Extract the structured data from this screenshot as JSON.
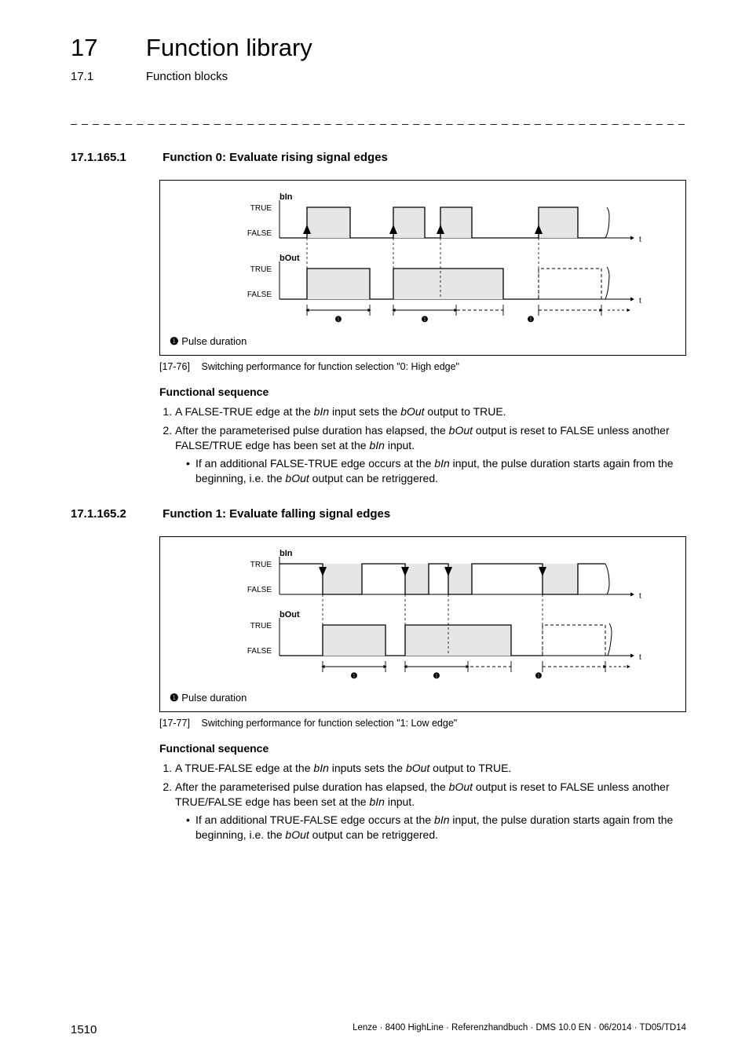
{
  "chapter": {
    "number": "17",
    "title": "Function library"
  },
  "subsection": {
    "number": "17.1",
    "title": "Function blocks"
  },
  "dashline": "_ _ _ _ _ _ _ _ _ _ _ _ _ _ _ _ _ _ _ _ _ _ _ _ _ _ _ _ _ _ _ _ _ _ _ _ _ _ _ _ _ _ _ _ _ _ _ _ _ _ _ _ _ _ _ _ _ _ _ _ _ _ _ _",
  "section1": {
    "number": "17.1.165.1",
    "title": "Function 0: Evaluate rising signal edges",
    "fig": {
      "bIn": "bIn",
      "bOut": "bOut",
      "TRUE": "TRUE",
      "FALSE": "FALSE",
      "t": "t",
      "marker": "❶",
      "legend": "Pulse duration",
      "captionNo": "[17-76]",
      "captionText": "Switching performance for function selection \"0: High edge\""
    },
    "funcSeqHead": "Functional sequence",
    "steps": {
      "s1a": "A FALSE-TRUE edge at the ",
      "s1b": " input sets the ",
      "s1c": " output to TRUE.",
      "s2a": "After the parameterised pulse duration has elapsed, the ",
      "s2b": " output is reset to FALSE unless another FALSE/TRUE edge has been set at the ",
      "s2c": " input.",
      "s2ba": "If an additional FALSE-TRUE edge occurs at the ",
      "s2bb": " input, the pulse duration starts again from the beginning, i.e. the ",
      "s2bc": " output can be retriggered."
    }
  },
  "section2": {
    "number": "17.1.165.2",
    "title": "Function 1: Evaluate falling signal edges",
    "fig": {
      "bIn": "bIn",
      "bOut": "bOut",
      "TRUE": "TRUE",
      "FALSE": "FALSE",
      "t": "t",
      "marker": "❶",
      "legend": "Pulse duration",
      "captionNo": "[17-77]",
      "captionText": "Switching performance for function selection \"1: Low edge\""
    },
    "funcSeqHead": "Functional sequence",
    "steps": {
      "s1a": "A TRUE-FALSE edge at the ",
      "s1b": " inputs sets the ",
      "s1c": " output to TRUE.",
      "s2a": "After the parameterised pulse duration has elapsed, the ",
      "s2b": " output is reset to FALSE unless another TRUE/FALSE edge has been set at the ",
      "s2c": " input.",
      "s2ba": "If an additional TRUE-FALSE edge occurs at the ",
      "s2bb": " input, the pulse duration starts again from the beginning, i.e. the ",
      "s2bc": " output can be retriggered."
    }
  },
  "terms": {
    "bIn": "bIn",
    "bOut": "bOut"
  },
  "footer": {
    "pageno": "1510",
    "meta": "Lenze · 8400 HighLine · Referenzhandbuch · DMS 10.0 EN · 06/2014 · TD05/TD14"
  }
}
